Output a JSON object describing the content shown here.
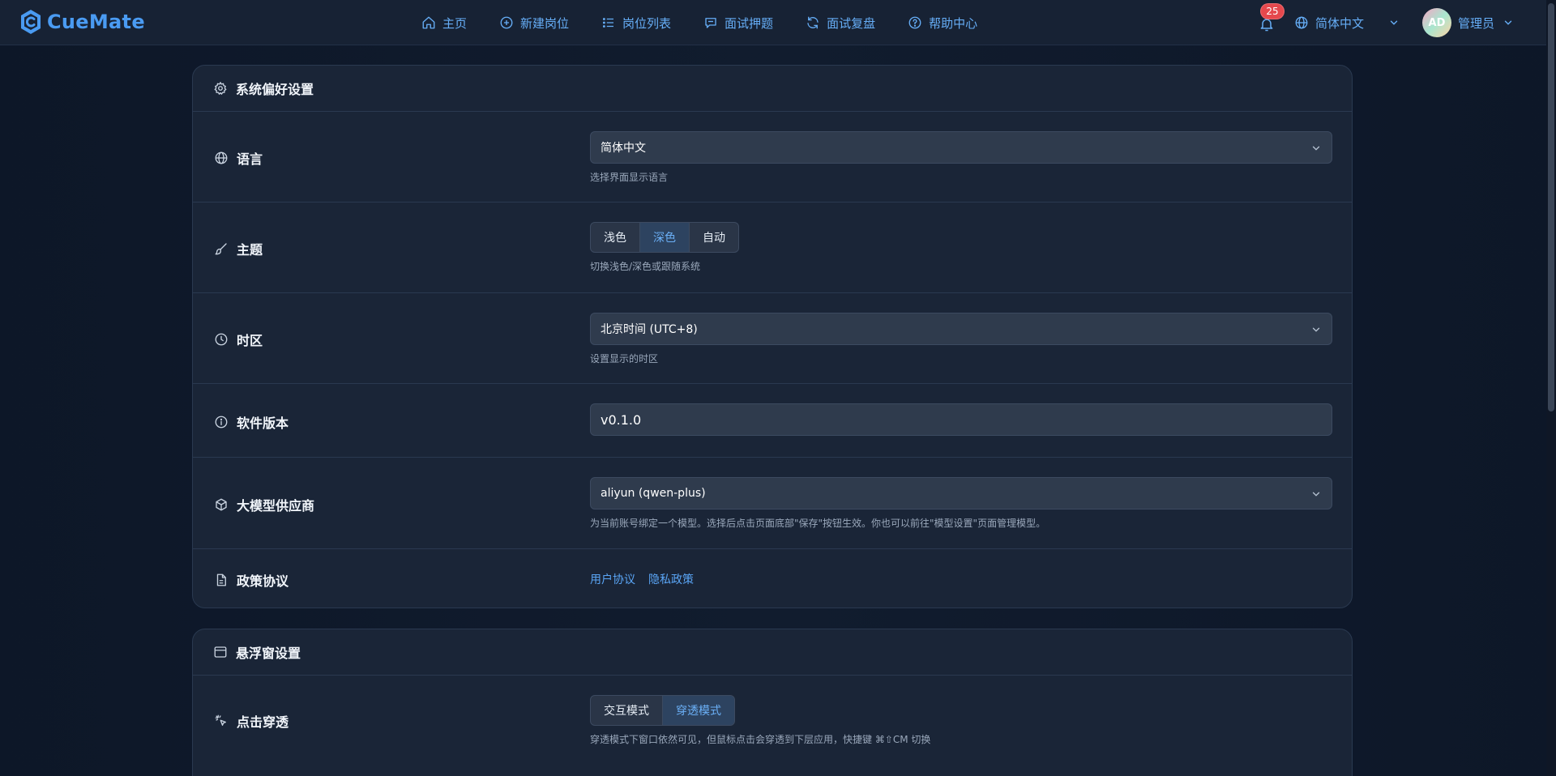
{
  "app": {
    "name": "CueMate"
  },
  "nav": [
    {
      "label": "主页",
      "icon": "home-icon"
    },
    {
      "label": "新建岗位",
      "icon": "plus-circle-icon"
    },
    {
      "label": "岗位列表",
      "icon": "list-icon"
    },
    {
      "label": "面试押题",
      "icon": "chat-icon"
    },
    {
      "label": "面试复盘",
      "icon": "refresh-icon"
    },
    {
      "label": "帮助中心",
      "icon": "help-icon"
    }
  ],
  "header": {
    "notification_count": "25",
    "language": "简体中文",
    "avatar_initials": "AD",
    "user_name": "管理员"
  },
  "system_settings": {
    "title": "系统偏好设置",
    "language": {
      "label": "语言",
      "value": "简体中文",
      "hint": "选择界面显示语言"
    },
    "theme": {
      "label": "主题",
      "options": [
        "浅色",
        "深色",
        "自动"
      ],
      "selected": "深色",
      "hint": "切换浅色/深色或跟随系统"
    },
    "timezone": {
      "label": "时区",
      "value": "北京时间 (UTC+8)",
      "hint": "设置显示的时区"
    },
    "version": {
      "label": "软件版本",
      "value": "v0.1.0"
    },
    "llm_provider": {
      "label": "大模型供应商",
      "value": "aliyun (qwen-plus)",
      "hint": "为当前账号绑定一个模型。选择后点击页面底部\"保存\"按钮生效。你也可以前往\"模型设置\"页面管理模型。"
    },
    "policy": {
      "label": "政策协议",
      "user_agreement": "用户协议",
      "privacy_policy": "隐私政策"
    }
  },
  "floating_window": {
    "title": "悬浮窗设置",
    "click_through": {
      "label": "点击穿透",
      "options": [
        "交互模式",
        "穿透模式"
      ],
      "selected": "穿透模式",
      "hint": "穿透模式下窗口依然可见，但鼠标点击会穿透到下层应用，快捷键 ⌘⇧CM 切换"
    }
  },
  "colors": {
    "accent": "#4a9bf2",
    "background": "#0d1728",
    "card": "#1a2537",
    "badge": "#e5484d"
  }
}
